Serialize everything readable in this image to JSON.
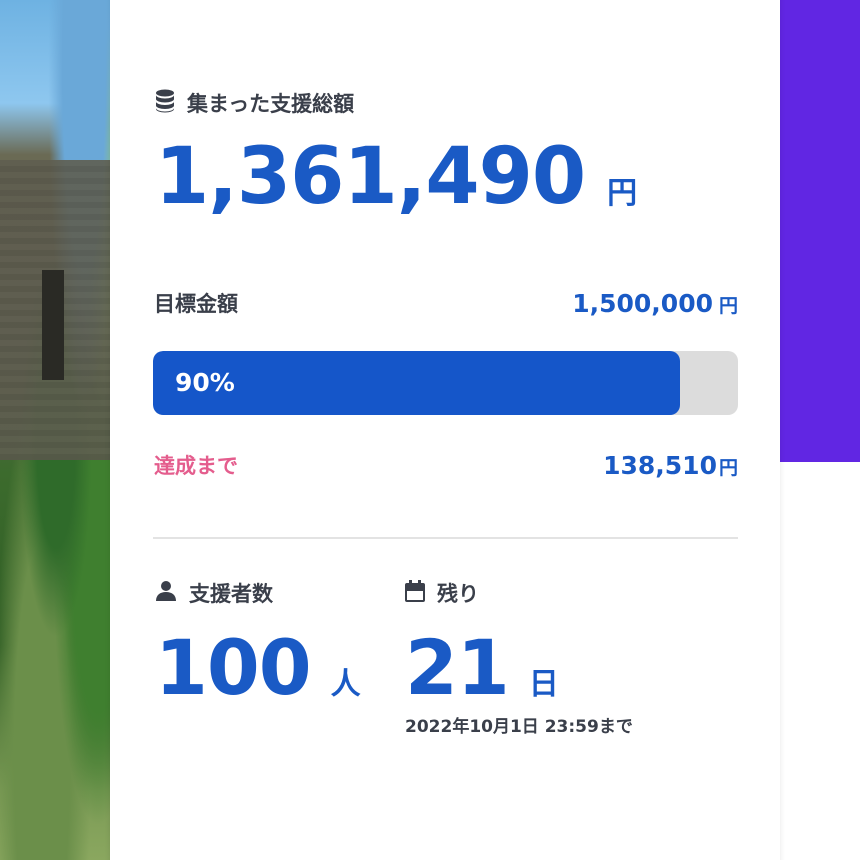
{
  "summary": {
    "total_label": "集まった支援総額",
    "total_amount": "1,361,490",
    "total_unit": "円",
    "goal_label": "目標金額",
    "goal_amount": "1,500,000",
    "goal_unit": "円",
    "progress_percent": 90,
    "progress_text": "90%",
    "remaining_label": "達成まで",
    "remaining_amount": "138,510",
    "remaining_unit": "円"
  },
  "stats": {
    "backers_label": "支援者数",
    "backers_value": "100",
    "backers_unit": "人",
    "days_label": "残り",
    "days_value": "21",
    "days_unit": "日",
    "deadline": "2022年10月1日 23:59まで"
  },
  "icons": {
    "total": "database-icon",
    "backers": "user-icon",
    "days": "calendar-icon"
  },
  "colors": {
    "accent": "#1a5ac5",
    "progress_fill": "#1556c9",
    "progress_track": "#dcdcdc",
    "remaining_label": "#e45d8d",
    "purple_panel": "#6126e3"
  }
}
